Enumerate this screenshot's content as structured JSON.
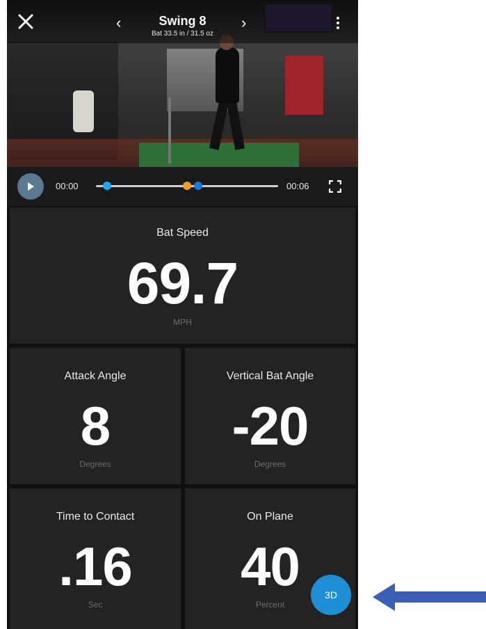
{
  "header": {
    "title": "Swing 8",
    "subtitle": "Bat 33.5 in / 31.5 oz",
    "prev_glyph": "‹",
    "next_glyph": "›",
    "close_icon": "close-icon",
    "more_icon": "more-vertical-icon"
  },
  "player": {
    "time_start": "00:00",
    "time_end": "00:06",
    "play_icon": "play-icon",
    "fullscreen_icon": "fullscreen-icon",
    "markers": [
      {
        "name": "start-marker",
        "color": "#1ea7f0",
        "position_fraction": 0.06
      },
      {
        "name": "impact-marker",
        "color": "#f0a021",
        "position_fraction": 0.5
      },
      {
        "name": "contact-marker",
        "color": "#1e7ad6",
        "position_fraction": 0.56
      }
    ]
  },
  "metrics": {
    "bat_speed": {
      "label": "Bat Speed",
      "value": "69.7",
      "unit": "MPH"
    },
    "attack_angle": {
      "label": "Attack Angle",
      "value": "8",
      "unit": "Degrees"
    },
    "vertical_bat_angle": {
      "label": "Vertical Bat Angle",
      "value": "-20",
      "unit": "Degrees"
    },
    "time_to_contact": {
      "label": "Time to Contact",
      "value": ".16",
      "unit": "Sec"
    },
    "on_plane": {
      "label": "On Plane",
      "value": "40",
      "unit": "Percent"
    }
  },
  "view_3d_button": {
    "label": "3D",
    "color": "#1e8ed6"
  },
  "annotation": {
    "arrow_color": "#3b5fb5",
    "icon": "left-arrow-icon"
  }
}
